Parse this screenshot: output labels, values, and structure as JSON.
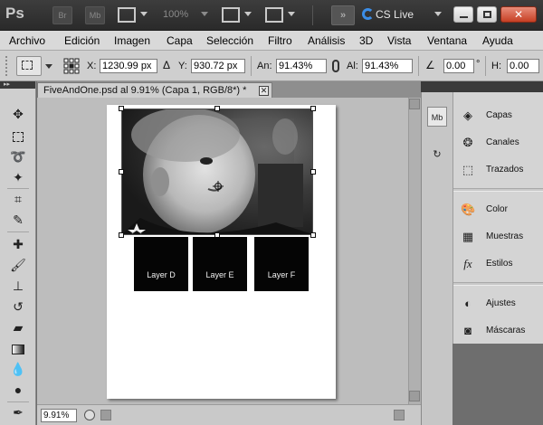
{
  "appbar": {
    "logo": "Ps",
    "bridge_label": "Br",
    "minibridge_label": "Mb",
    "zoom": "100%",
    "extend_label": "»",
    "cslive_label": "CS Live",
    "close_glyph": "✕"
  },
  "menu": [
    "Archivo",
    "Edición",
    "Imagen",
    "Capa",
    "Selección",
    "Filtro",
    "Análisis",
    "3D",
    "Vista",
    "Ventana",
    "Ayuda"
  ],
  "options": {
    "x_label": "X:",
    "x_value": "1230.99 px",
    "y_label": "Y:",
    "y_value": "930.72 px",
    "w_label": "An:",
    "w_value": "91.43%",
    "h_label": "Al:",
    "h_value": "91.43%",
    "angle_value": "0.00",
    "angle_unit": "°",
    "hskew_label": "H:",
    "hskew_value": "0.00"
  },
  "document": {
    "tab_title": "FiveAndOne.psd al 9.91% (Capa 1, RGB/8*) *",
    "zoom_value": "9.91%",
    "layers": [
      "Layer D",
      "Layer E",
      "Layer F"
    ]
  },
  "panels": {
    "group1": [
      "Capas",
      "Canales",
      "Trazados"
    ],
    "group2": [
      "Color",
      "Muestras",
      "Estilos"
    ],
    "group3": [
      "Ajustes",
      "Máscaras"
    ]
  },
  "colors": {
    "accent": "#3b8ee8",
    "close_red": "#c63f24"
  }
}
